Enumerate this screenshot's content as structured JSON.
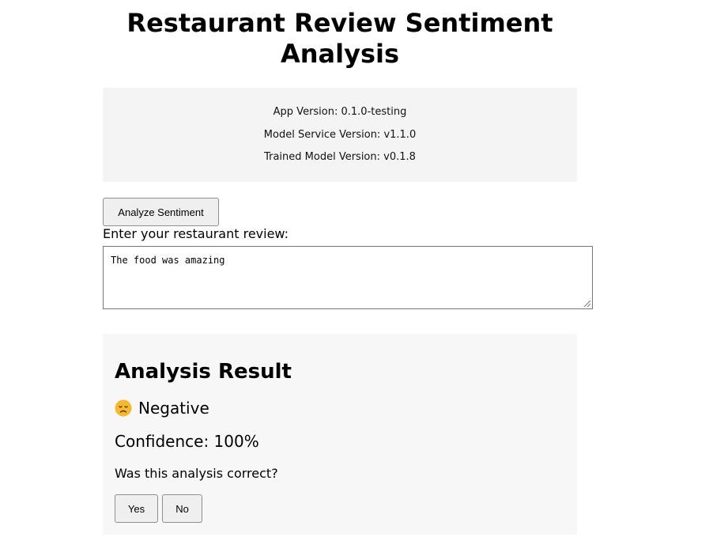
{
  "header": {
    "title": "Restaurant Review Sentiment Analysis"
  },
  "versions": {
    "app": "App Version: 0.1.0-testing",
    "model_service": "Model Service Version: v1.1.0",
    "trained_model": "Trained Model Version: v0.1.8"
  },
  "form": {
    "analyze_button_label": "Analyze Sentiment",
    "review_label": "Enter your restaurant review:",
    "review_value": "The food was amazing"
  },
  "result": {
    "heading": "Analysis Result",
    "sentiment_icon": "sad-face-icon",
    "sentiment_label": "Negative",
    "confidence_text": "Confidence: 100%",
    "feedback_question": "Was this analysis correct?",
    "yes_label": "Yes",
    "no_label": "No"
  },
  "colors": {
    "panel_background": "#f4f4f4",
    "result_background": "#f7f7f7",
    "button_background": "#efefef",
    "emoji_face": "#f5b82e"
  }
}
